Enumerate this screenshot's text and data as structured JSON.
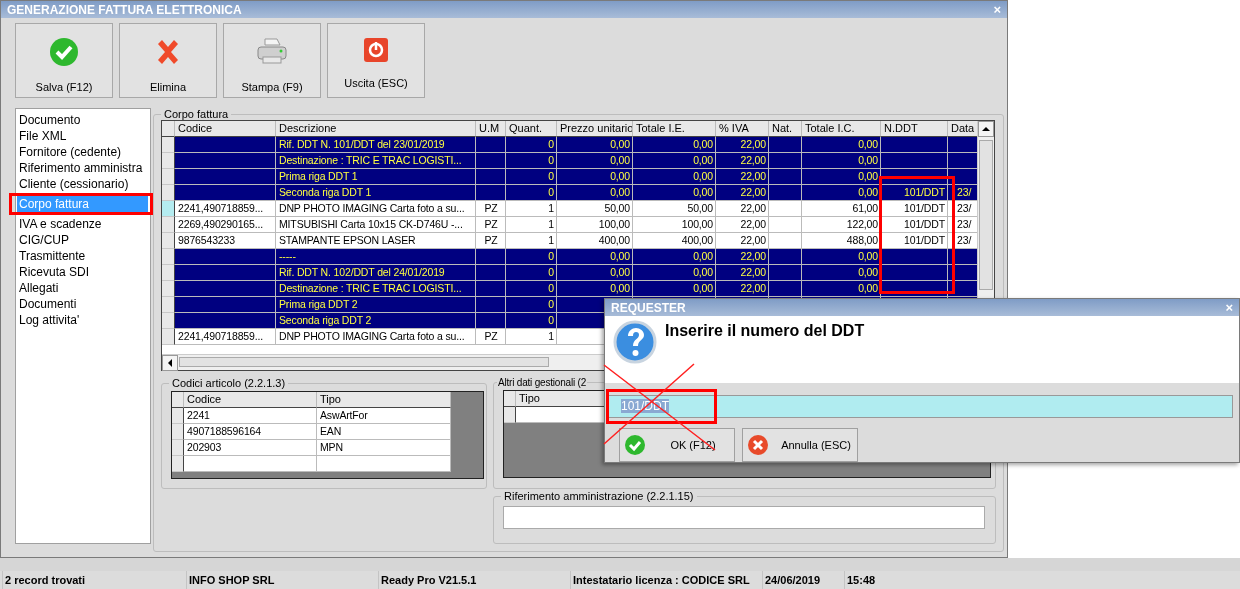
{
  "window": {
    "title": "GENERAZIONE FATTURA ELETTRONICA",
    "close": "×"
  },
  "toolbar": [
    {
      "label": "Salva (F12)",
      "kind": "save"
    },
    {
      "label": "Elimina",
      "kind": "delete"
    },
    {
      "label": "Stampa (F9)",
      "kind": "print"
    },
    {
      "label": "Uscita (ESC)",
      "kind": "exit"
    }
  ],
  "sidebar": {
    "items": [
      {
        "label": "Documento",
        "selected": false
      },
      {
        "label": "File XML",
        "selected": false
      },
      {
        "label": "Fornitore (cedente)",
        "selected": false
      },
      {
        "label": "Riferimento amministra",
        "selected": false
      },
      {
        "label": "Cliente (cessionario)",
        "selected": false
      },
      {
        "label": "Corpo fattura",
        "selected": true
      },
      {
        "label": "IVA e scadenze",
        "selected": false
      },
      {
        "label": "CIG/CUP",
        "selected": false
      },
      {
        "label": "Trasmittente",
        "selected": false
      },
      {
        "label": "Ricevuta SDI",
        "selected": false
      },
      {
        "label": "Allegati",
        "selected": false
      },
      {
        "label": "Documenti",
        "selected": false
      },
      {
        "label": "Log attivita'",
        "selected": false
      }
    ]
  },
  "invoice_body": {
    "title": "Corpo fattura",
    "columns": [
      "Codice",
      "Descrizione",
      "U.M",
      "Quant.",
      "Prezzo unitario",
      "Totale I.E.",
      "% IVA",
      "Nat.",
      "Totale I.C.",
      "N.DDT",
      "Data"
    ],
    "rows": [
      {
        "kind": "ddt",
        "selected": false,
        "cells": [
          null,
          "Rif. DDT N. 101/DDT del 23/01/2019",
          null,
          "0",
          "0,00",
          "0,00",
          "22,00",
          null,
          "0,00",
          null,
          null
        ]
      },
      {
        "kind": "ddt",
        "selected": false,
        "cells": [
          null,
          "Destinazione : TRIC E TRAC LOGISTI...",
          null,
          "0",
          "0,00",
          "0,00",
          "22,00",
          null,
          "0,00",
          null,
          null
        ]
      },
      {
        "kind": "ddt",
        "selected": false,
        "cells": [
          null,
          "Prima riga DDT 1",
          null,
          "0",
          "0,00",
          "0,00",
          "22,00",
          null,
          "0,00",
          null,
          null
        ]
      },
      {
        "kind": "ddt",
        "selected": false,
        "cells": [
          null,
          "Seconda riga DDT 1",
          null,
          "0",
          "0,00",
          "0,00",
          "22,00",
          null,
          "0,00",
          "101/DDT",
          "23/"
        ]
      },
      {
        "kind": "item",
        "selected": true,
        "cells": [
          "2241,490718859...",
          "DNP PHOTO IMAGING Carta foto a su...",
          "PZ",
          "1",
          "50,00",
          "50,00",
          "22,00",
          null,
          "61,00",
          "101/DDT",
          "23/"
        ]
      },
      {
        "kind": "item",
        "selected": false,
        "cells": [
          "2269,490290165...",
          "MITSUBISHI Carta 10x15 CK-D746U -...",
          "PZ",
          "1",
          "100,00",
          "100,00",
          "22,00",
          null,
          "122,00",
          "101/DDT",
          "23/"
        ]
      },
      {
        "kind": "item",
        "selected": false,
        "cells": [
          "9876543233",
          "STAMPANTE EPSON LASER",
          "PZ",
          "1",
          "400,00",
          "400,00",
          "22,00",
          null,
          "488,00",
          "101/DDT",
          "23/"
        ]
      },
      {
        "kind": "ddt",
        "selected": false,
        "cells": [
          null,
          "-----",
          null,
          "0",
          "0,00",
          "0,00",
          "22,00",
          null,
          "0,00",
          null,
          null
        ]
      },
      {
        "kind": "ddt",
        "selected": false,
        "cells": [
          null,
          "Rif. DDT N. 102/DDT del 24/01/2019",
          null,
          "0",
          "0,00",
          "0,00",
          "22,00",
          null,
          "0,00",
          null,
          null
        ]
      },
      {
        "kind": "ddt",
        "selected": false,
        "cells": [
          null,
          "Destinazione : TRIC E TRAC LOGISTI...",
          null,
          "0",
          "0,00",
          "0,00",
          "22,00",
          null,
          "0,00",
          null,
          null
        ]
      },
      {
        "kind": "ddt",
        "selected": false,
        "cells": [
          null,
          "Prima riga DDT 2",
          null,
          "0"
        ]
      },
      {
        "kind": "ddt",
        "selected": false,
        "cells": [
          null,
          "Seconda riga DDT 2",
          null,
          "0"
        ]
      },
      {
        "kind": "item",
        "selected": false,
        "cells": [
          "2241,490718859...",
          "DNP PHOTO IMAGING Carta foto a su...",
          "PZ",
          "1"
        ]
      }
    ]
  },
  "article_codes": {
    "title": "Codici articolo (2.2.1.3)",
    "columns": [
      "Codice",
      "Tipo"
    ],
    "rows": [
      [
        "2241",
        "AswArtFor"
      ],
      [
        "4907188596164",
        "EAN"
      ],
      [
        "202903",
        "MPN"
      ],
      [
        null,
        null
      ]
    ]
  },
  "other_data": {
    "title": "Altri dati gestionali (2",
    "columns": [
      "Tipo"
    ]
  },
  "admin_reference": {
    "title": "Riferimento amministrazione (2.2.1.15)"
  },
  "dialog": {
    "title": "REQUESTER",
    "close": "×",
    "prompt": "Inserire il numero del DDT",
    "value": "101/DDT",
    "value_selected": true,
    "buttons": [
      {
        "label": "OK (F12)",
        "kind": "ok"
      },
      {
        "label": "Annulla (ESC)",
        "kind": "cancel"
      }
    ]
  },
  "status_bar": [
    "2 record trovati",
    "INFO SHOP SRL",
    "Ready Pro V21.5.1",
    "Intestatario licenza : CODICE SRL",
    "24/06/2019",
    "15:48"
  ]
}
